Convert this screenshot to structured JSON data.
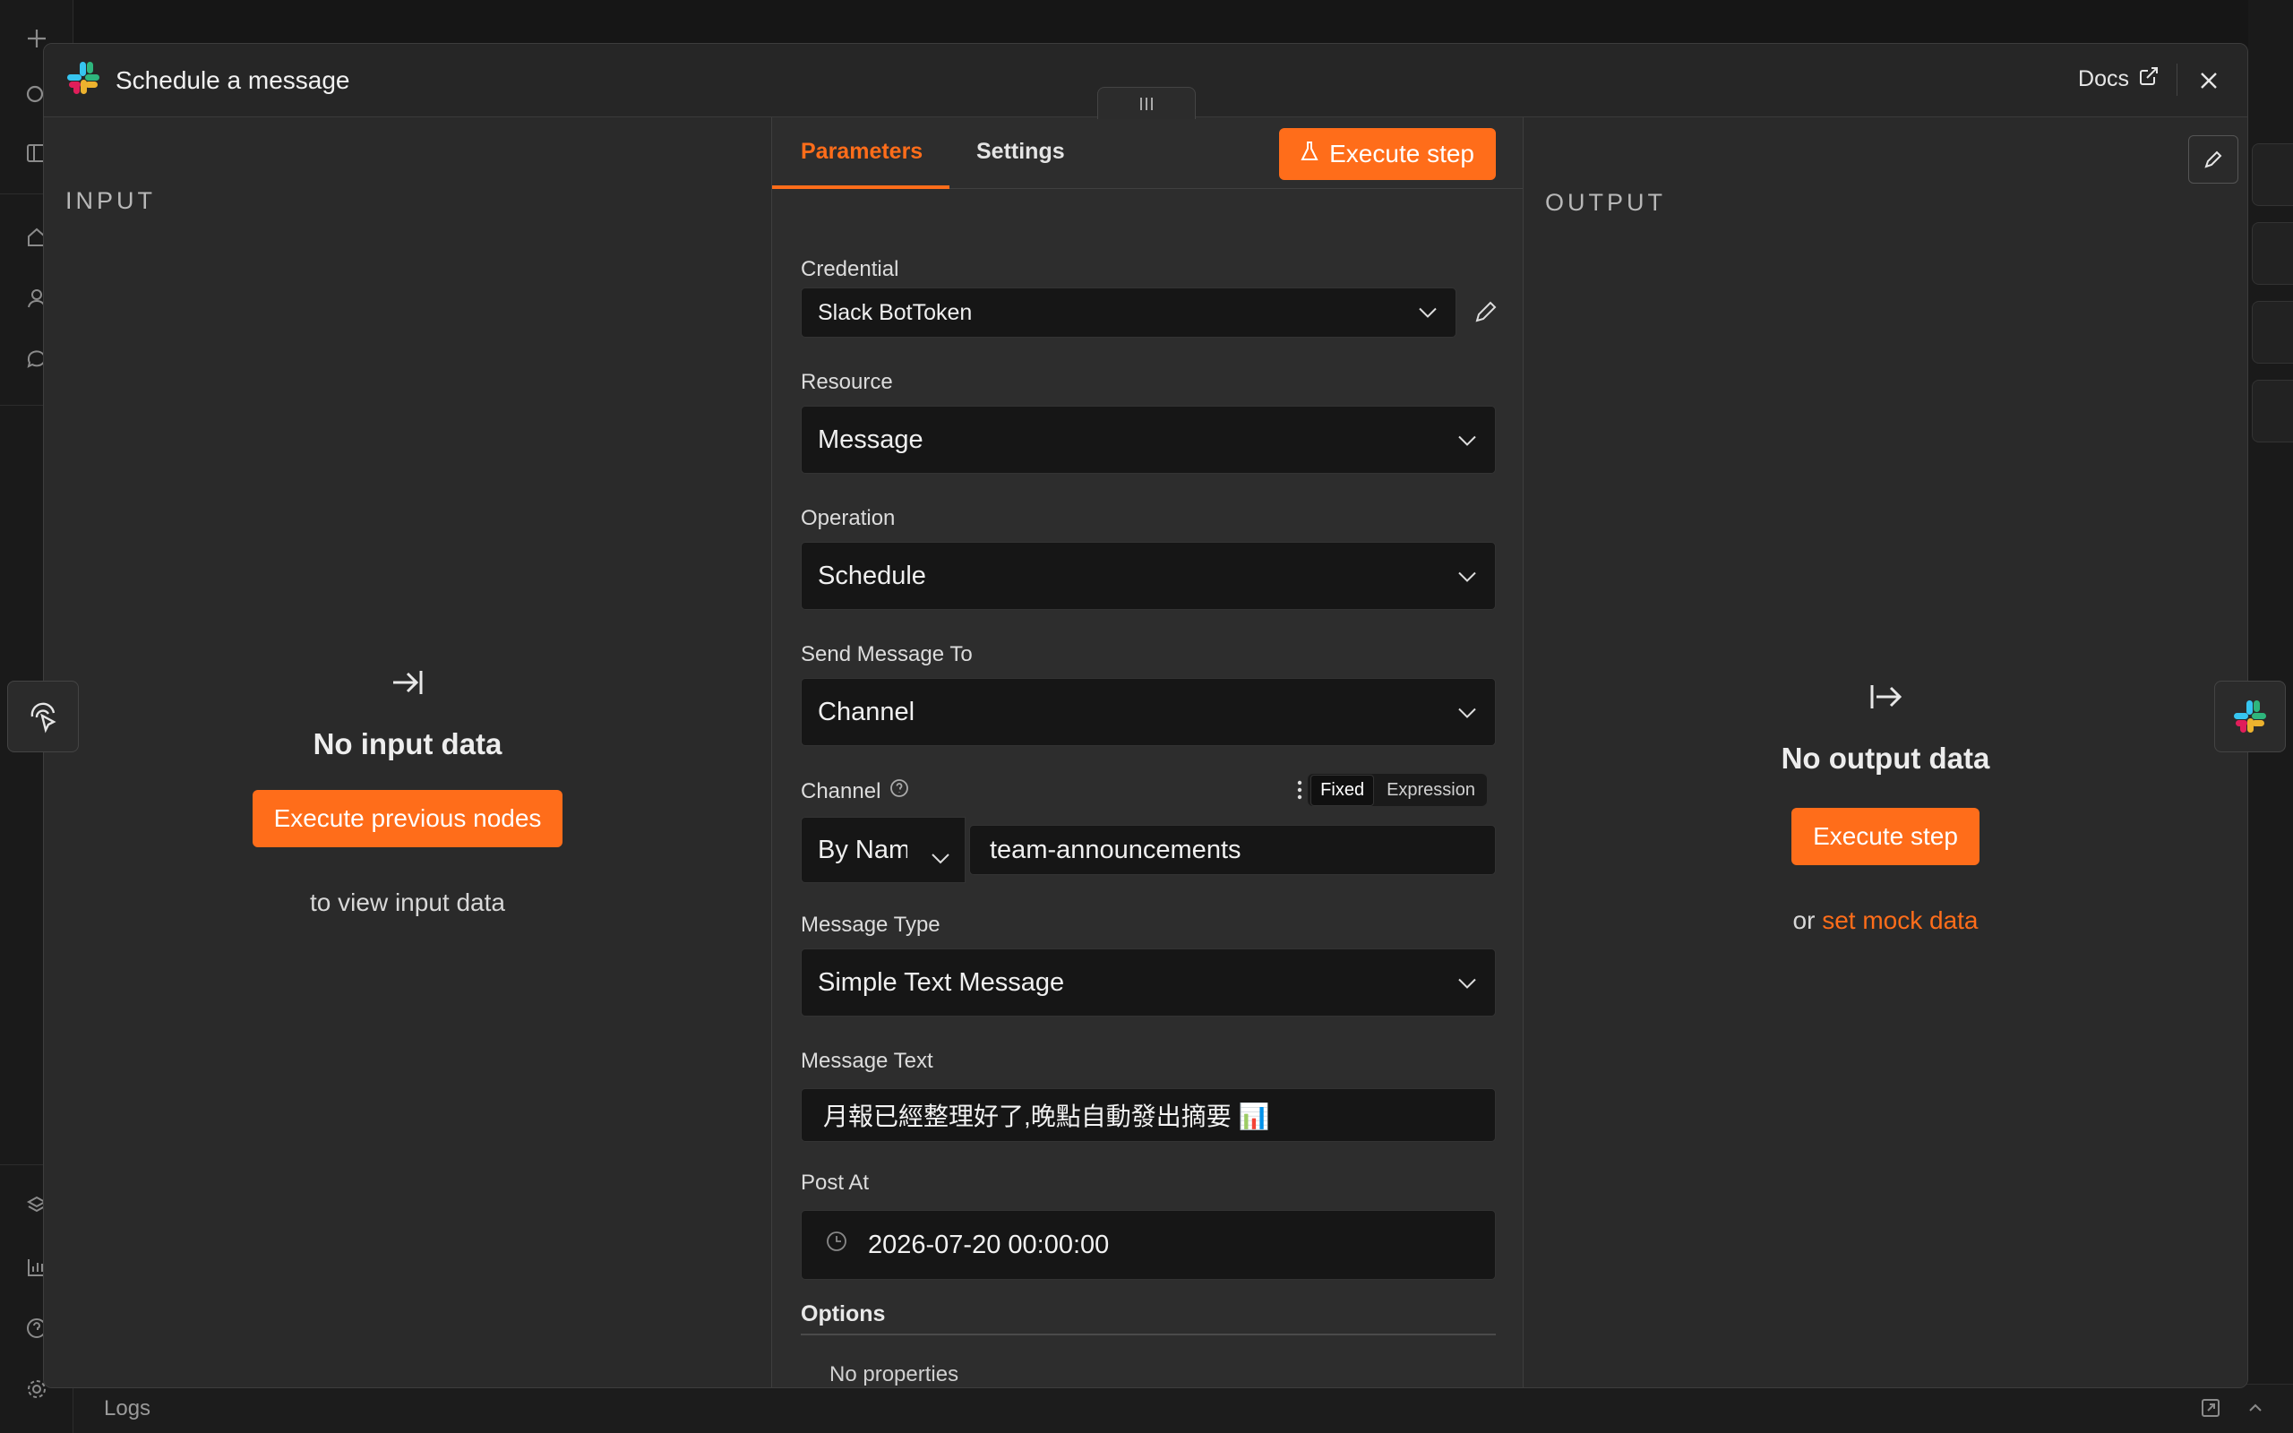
{
  "window": {
    "title": "Schedule a message"
  },
  "header": {
    "docs_label": "Docs"
  },
  "input_panel": {
    "label": "INPUT",
    "empty_title": "No input data",
    "button": "Execute previous nodes",
    "sub": "to view input data"
  },
  "tabs": {
    "parameters": "Parameters",
    "settings": "Settings",
    "execute": "Execute step"
  },
  "params": {
    "credential": {
      "label": "Credential",
      "value": "Slack BotToken"
    },
    "resource": {
      "label": "Resource",
      "value": "Message"
    },
    "operation": {
      "label": "Operation",
      "value": "Schedule"
    },
    "send_to": {
      "label": "Send Message To",
      "value": "Channel"
    },
    "channel": {
      "label": "Channel",
      "mode_fixed": "Fixed",
      "mode_expression": "Expression",
      "by": "By Name",
      "value": "team-announcements"
    },
    "message_type": {
      "label": "Message Type",
      "value": "Simple Text Message"
    },
    "message_text": {
      "label": "Message Text",
      "value": "月報已經整理好了,晚點自動發出摘要 📊"
    },
    "post_at": {
      "label": "Post At",
      "value": "2026-07-20 00:00:00"
    },
    "options": {
      "label": "Options",
      "empty": "No properties"
    }
  },
  "output_panel": {
    "label": "OUTPUT",
    "empty_title": "No output data",
    "button": "Execute step",
    "sub_prefix": "or",
    "sub_link": "set mock data"
  },
  "footer": {
    "logs": "Logs"
  },
  "colors": {
    "accent": "#ff6d1a",
    "panel": "#2a2a2a",
    "field": "#161616"
  }
}
